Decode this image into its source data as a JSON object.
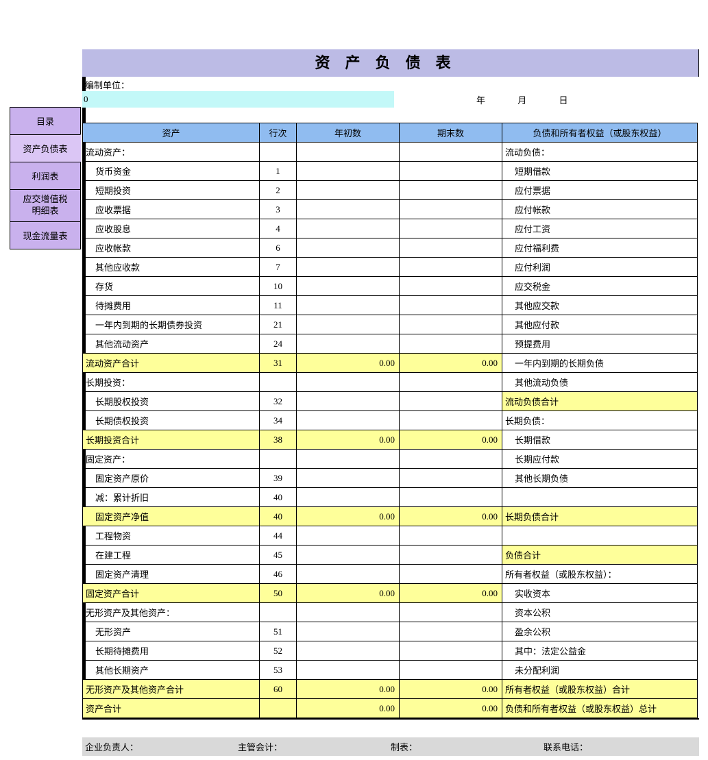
{
  "sidebar": {
    "tabs": [
      {
        "label": "目录"
      },
      {
        "label": "资产负债表"
      },
      {
        "label": "利润表"
      },
      {
        "label": "应交增值税\n明细表"
      },
      {
        "label": "现金流量表"
      }
    ]
  },
  "title": "资产负债表",
  "meta": {
    "org_label": "编制单位：",
    "zero": "0",
    "year": "年",
    "month": "月",
    "day": "日"
  },
  "headers": {
    "asset": "资产",
    "line": "行次",
    "begin": "年初数",
    "end": "期末数",
    "liab": "负债和所有者权益（或股东权益）"
  },
  "rows": [
    {
      "a": "流动资产：",
      "ln": "",
      "b": "",
      "e": "",
      "r": "流动负债：",
      "ai": 0,
      "ri": 0
    },
    {
      "a": "货币资金",
      "ln": "1",
      "b": "",
      "e": "",
      "r": "短期借款",
      "ai": 1,
      "ri": 1
    },
    {
      "a": "短期投资",
      "ln": "2",
      "b": "",
      "e": "",
      "r": "应付票据",
      "ai": 1,
      "ri": 1
    },
    {
      "a": "应收票据",
      "ln": "3",
      "b": "",
      "e": "",
      "r": "应付帐款",
      "ai": 1,
      "ri": 1
    },
    {
      "a": "应收股息",
      "ln": "4",
      "b": "",
      "e": "",
      "r": "应付工资",
      "ai": 1,
      "ri": 1
    },
    {
      "a": "应收帐款",
      "ln": "6",
      "b": "",
      "e": "",
      "r": "应付福利费",
      "ai": 1,
      "ri": 1
    },
    {
      "a": "其他应收款",
      "ln": "7",
      "b": "",
      "e": "",
      "r": "应付利润",
      "ai": 1,
      "ri": 1
    },
    {
      "a": "存货",
      "ln": "10",
      "b": "",
      "e": "",
      "r": "应交税金",
      "ai": 1,
      "ri": 1
    },
    {
      "a": "待摊费用",
      "ln": "11",
      "b": "",
      "e": "",
      "r": "其他应交款",
      "ai": 1,
      "ri": 1
    },
    {
      "a": "一年内到期的长期债券投资",
      "ln": "21",
      "b": "",
      "e": "",
      "r": "其他应付款",
      "ai": 1,
      "ri": 1
    },
    {
      "a": "其他流动资产",
      "ln": "24",
      "b": "",
      "e": "",
      "r": "预提费用",
      "ai": 1,
      "ri": 1
    },
    {
      "a": "流动资产合计",
      "ln": "31",
      "b": "0.00",
      "e": "0.00",
      "r": "一年内到期的长期负债",
      "ai": 0,
      "ri": 1,
      "yl": 1
    },
    {
      "a": "长期投资：",
      "ln": "",
      "b": "",
      "e": "",
      "r": "其他流动负债",
      "ai": 0,
      "ri": 1
    },
    {
      "a": "长期股权投资",
      "ln": "32",
      "b": "",
      "e": "",
      "r": "流动负债合计",
      "ai": 1,
      "ri": 0,
      "yr": 1
    },
    {
      "a": "长期债权投资",
      "ln": "34",
      "b": "",
      "e": "",
      "r": "长期负债：",
      "ai": 1,
      "ri": 0
    },
    {
      "a": "长期投资合计",
      "ln": "38",
      "b": "0.00",
      "e": "0.00",
      "r": "长期借款",
      "ai": 0,
      "ri": 1,
      "yl": 1
    },
    {
      "a": "固定资产：",
      "ln": "",
      "b": "",
      "e": "",
      "r": "长期应付款",
      "ai": 0,
      "ri": 1
    },
    {
      "a": "固定资产原价",
      "ln": "39",
      "b": "",
      "e": "",
      "r": "其他长期负债",
      "ai": 1,
      "ri": 1
    },
    {
      "a": "减：累计折旧",
      "ln": "40",
      "b": "",
      "e": "",
      "r": "",
      "ai": 1,
      "ri": 0
    },
    {
      "a": "固定资产净值",
      "ln": "40",
      "b": "0.00",
      "e": "0.00",
      "r": "长期负债合计",
      "ai": 1,
      "ri": 0,
      "yl": 1,
      "yr": 1
    },
    {
      "a": "工程物资",
      "ln": "44",
      "b": "",
      "e": "",
      "r": "",
      "ai": 1,
      "ri": 0
    },
    {
      "a": "在建工程",
      "ln": "45",
      "b": "",
      "e": "",
      "r": "负债合计",
      "ai": 1,
      "ri": 0,
      "yr": 1
    },
    {
      "a": "固定资产清理",
      "ln": "46",
      "b": "",
      "e": "",
      "r": "所有者权益（或股东权益）：",
      "ai": 1,
      "ri": 0
    },
    {
      "a": "固定资产合计",
      "ln": "50",
      "b": "0.00",
      "e": "0.00",
      "r": "实收资本",
      "ai": 0,
      "ri": 1,
      "yl": 1
    },
    {
      "a": "无形资产及其他资产：",
      "ln": "",
      "b": "",
      "e": "",
      "r": "资本公积",
      "ai": 0,
      "ri": 1
    },
    {
      "a": "无形资产",
      "ln": "51",
      "b": "",
      "e": "",
      "r": "盈余公积",
      "ai": 1,
      "ri": 1
    },
    {
      "a": "长期待摊费用",
      "ln": "52",
      "b": "",
      "e": "",
      "r": "其中：法定公益金",
      "ai": 1,
      "ri": 1
    },
    {
      "a": "其他长期资产",
      "ln": "53",
      "b": "",
      "e": "",
      "r": "未分配利润",
      "ai": 1,
      "ri": 1
    },
    {
      "a": "无形资产及其他资产合计",
      "ln": "60",
      "b": "0.00",
      "e": "0.00",
      "r": "所有者权益（或股东权益）合计",
      "ai": 0,
      "ri": 0,
      "yl": 1,
      "yr": 1
    },
    {
      "a": "资产合计",
      "ln": "",
      "b": "0.00",
      "e": "0.00",
      "r": "负债和所有者权益（或股东权益）总计",
      "ai": 0,
      "ri": 0,
      "yl": 1,
      "yr": 1
    }
  ],
  "footer": {
    "f1": "企业负责人：",
    "f2": "主管会计：",
    "f3": "制表：",
    "f4": "联系电话："
  }
}
